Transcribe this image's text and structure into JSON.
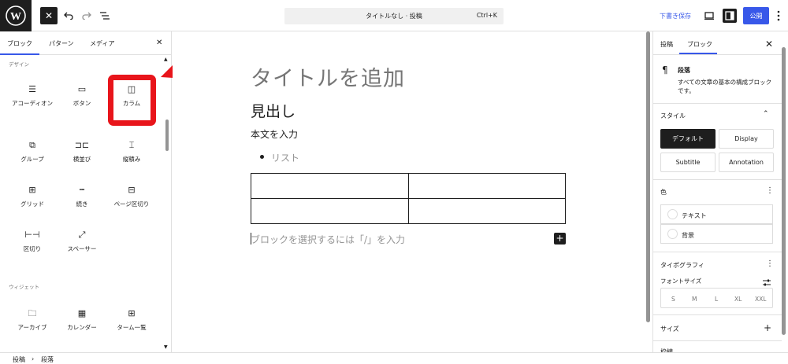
{
  "topbar": {
    "close_label": "✕",
    "command_title": "タイトルなし · 投稿",
    "command_shortcut": "Ctrl+K",
    "save_draft_label": "下書き保存",
    "publish_label": "公開"
  },
  "inserter": {
    "tabs": [
      "ブロック",
      "パターン",
      "メディア"
    ],
    "close_label": "✕",
    "category_design": "デザイン",
    "design_blocks": [
      {
        "label": "アコーディオン",
        "icon": "accordion-icon"
      },
      {
        "label": "ボタン",
        "icon": "buttons-icon"
      },
      {
        "label": "カラム",
        "icon": "columns-icon"
      },
      {
        "label": "グループ",
        "icon": "group-icon"
      },
      {
        "label": "横並び",
        "icon": "row-icon"
      },
      {
        "label": "縦積み",
        "icon": "stack-icon"
      },
      {
        "label": "グリッド",
        "icon": "grid-icon"
      },
      {
        "label": "続き",
        "icon": "more-icon"
      },
      {
        "label": "ページ区切り",
        "icon": "page-break-icon"
      },
      {
        "label": "区切り",
        "icon": "separator-icon"
      },
      {
        "label": "スペーサー",
        "icon": "spacer-icon"
      }
    ],
    "category_widgets": "ウィジェット",
    "widget_blocks": [
      {
        "label": "アーカイブ",
        "icon": "archive-icon"
      },
      {
        "label": "カレンダー",
        "icon": "calendar-icon"
      },
      {
        "label": "ターム一覧",
        "icon": "terms-list-icon"
      }
    ]
  },
  "editor": {
    "title_placeholder": "タイトルを追加",
    "heading": "見出し",
    "paragraph": "本文を入力",
    "list_item": "リスト",
    "appender_placeholder": "ブロックを選択するには「/」を入力",
    "plus_label": "+"
  },
  "sidebar": {
    "tabs": [
      "投稿",
      "ブロック"
    ],
    "close_label": "✕",
    "block_name": "段落",
    "block_desc": "すべての文章の基本の構成ブロックです。",
    "style_heading": "スタイル",
    "styles": [
      "デフォルト",
      "Display",
      "Subtitle",
      "Annotation"
    ],
    "color_heading": "色",
    "colors": [
      "テキスト",
      "背景"
    ],
    "typography_heading": "タイポグラフィ",
    "font_size_label": "フォントサイズ",
    "font_sizes": [
      "S",
      "M",
      "L",
      "XL",
      "XXL"
    ],
    "size_heading": "サイズ",
    "next_heading": "枠線"
  },
  "footer": {
    "breadcrumb": [
      "投稿",
      "段落"
    ]
  },
  "colors": {
    "accent": "#3858e9",
    "annotation_red": "#e8151b",
    "dark": "#1e1e1e"
  }
}
